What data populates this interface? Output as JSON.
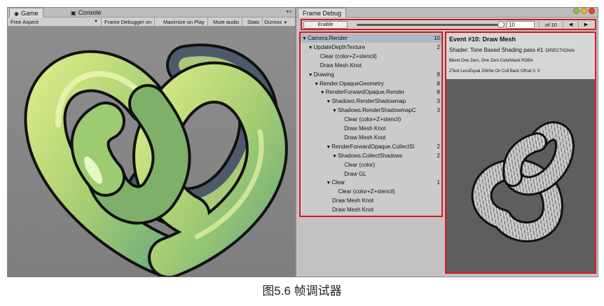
{
  "game_window": {
    "tabs": [
      {
        "label": "Game",
        "icon": "game-icon"
      },
      {
        "label": "Console",
        "icon": "console-icon"
      }
    ],
    "toolbar": {
      "aspect": "Free Aspect",
      "frame_debugger": "Frame Debugger on",
      "maximize": "Maximize on Play",
      "mute": "Mute audio",
      "stats": "Stats",
      "gizmos": "Gizmos"
    }
  },
  "frame_debug": {
    "tab_label": "Frame Debug",
    "enable_label": "Enable",
    "slider_position": 1.0,
    "event_field_value": "10",
    "of_label": "of 10",
    "prev_icon": "◀",
    "next_icon": "▶",
    "hierarchy": [
      {
        "label": "Camera.Render",
        "count": "10",
        "indent": 0,
        "expanded": true
      },
      {
        "label": "UpdateDepthTexture",
        "count": "2",
        "indent": 1,
        "expanded": true
      },
      {
        "label": "Clear (color+Z+stencil)",
        "count": "",
        "indent": 3,
        "expanded": false
      },
      {
        "label": "Draw Mesh Knot",
        "count": "",
        "indent": 3,
        "expanded": false
      },
      {
        "label": "Drawing",
        "count": "8",
        "indent": 1,
        "expanded": true
      },
      {
        "label": "Render.OpaqueGeometry",
        "count": "8",
        "indent": 2,
        "expanded": true
      },
      {
        "label": "RenderForwardOpaque.Render",
        "count": "8",
        "indent": 3,
        "expanded": true
      },
      {
        "label": "Shadows.RenderShadowmap",
        "count": "3",
        "indent": 4,
        "expanded": true
      },
      {
        "label": "Shadows.RenderShadowmapC",
        "count": "3",
        "indent": 5,
        "expanded": true
      },
      {
        "label": "Clear (color+Z+stencil)",
        "count": "",
        "indent": 7,
        "expanded": false
      },
      {
        "label": "Draw Mesh Knot",
        "count": "",
        "indent": 7,
        "expanded": false
      },
      {
        "label": "Draw Mesh Knot",
        "count": "",
        "indent": 7,
        "expanded": false
      },
      {
        "label": "RenderForwardOpaque.CollectSl",
        "count": "2",
        "indent": 4,
        "expanded": true
      },
      {
        "label": "Shadows.CollectShadows",
        "count": "2",
        "indent": 5,
        "expanded": true
      },
      {
        "label": "Clear (color)",
        "count": "",
        "indent": 7,
        "expanded": false
      },
      {
        "label": "Draw GL",
        "count": "",
        "indent": 7,
        "expanded": false
      },
      {
        "label": "Clear",
        "count": "1",
        "indent": 4,
        "expanded": true
      },
      {
        "label": "Clear (color+Z+stencil)",
        "count": "",
        "indent": 6,
        "expanded": false
      },
      {
        "label": "Draw Mesh Knot",
        "count": "",
        "indent": 5,
        "expanded": false
      },
      {
        "label": "Draw Mesh Knot",
        "count": "",
        "indent": 5,
        "expanded": false
      }
    ],
    "details": {
      "title": "Event #10: Draw Mesh",
      "shader": "Shader: Tone Based Shading pass #1",
      "shader_extra": "DIRECTIONAl",
      "blend": "Blend One Zero, One Zero ColorMask RGBA",
      "ztest": "ZTest LessEqual ZWrite On Cull Back Offset 0, 0"
    }
  },
  "caption": "图5.6 帧调试器",
  "colors": {
    "highlight": "#d21d1d",
    "knot_light": "#c9e07a",
    "knot_mid": "#8fbf6a",
    "knot_dark": "#3d4a5c"
  }
}
